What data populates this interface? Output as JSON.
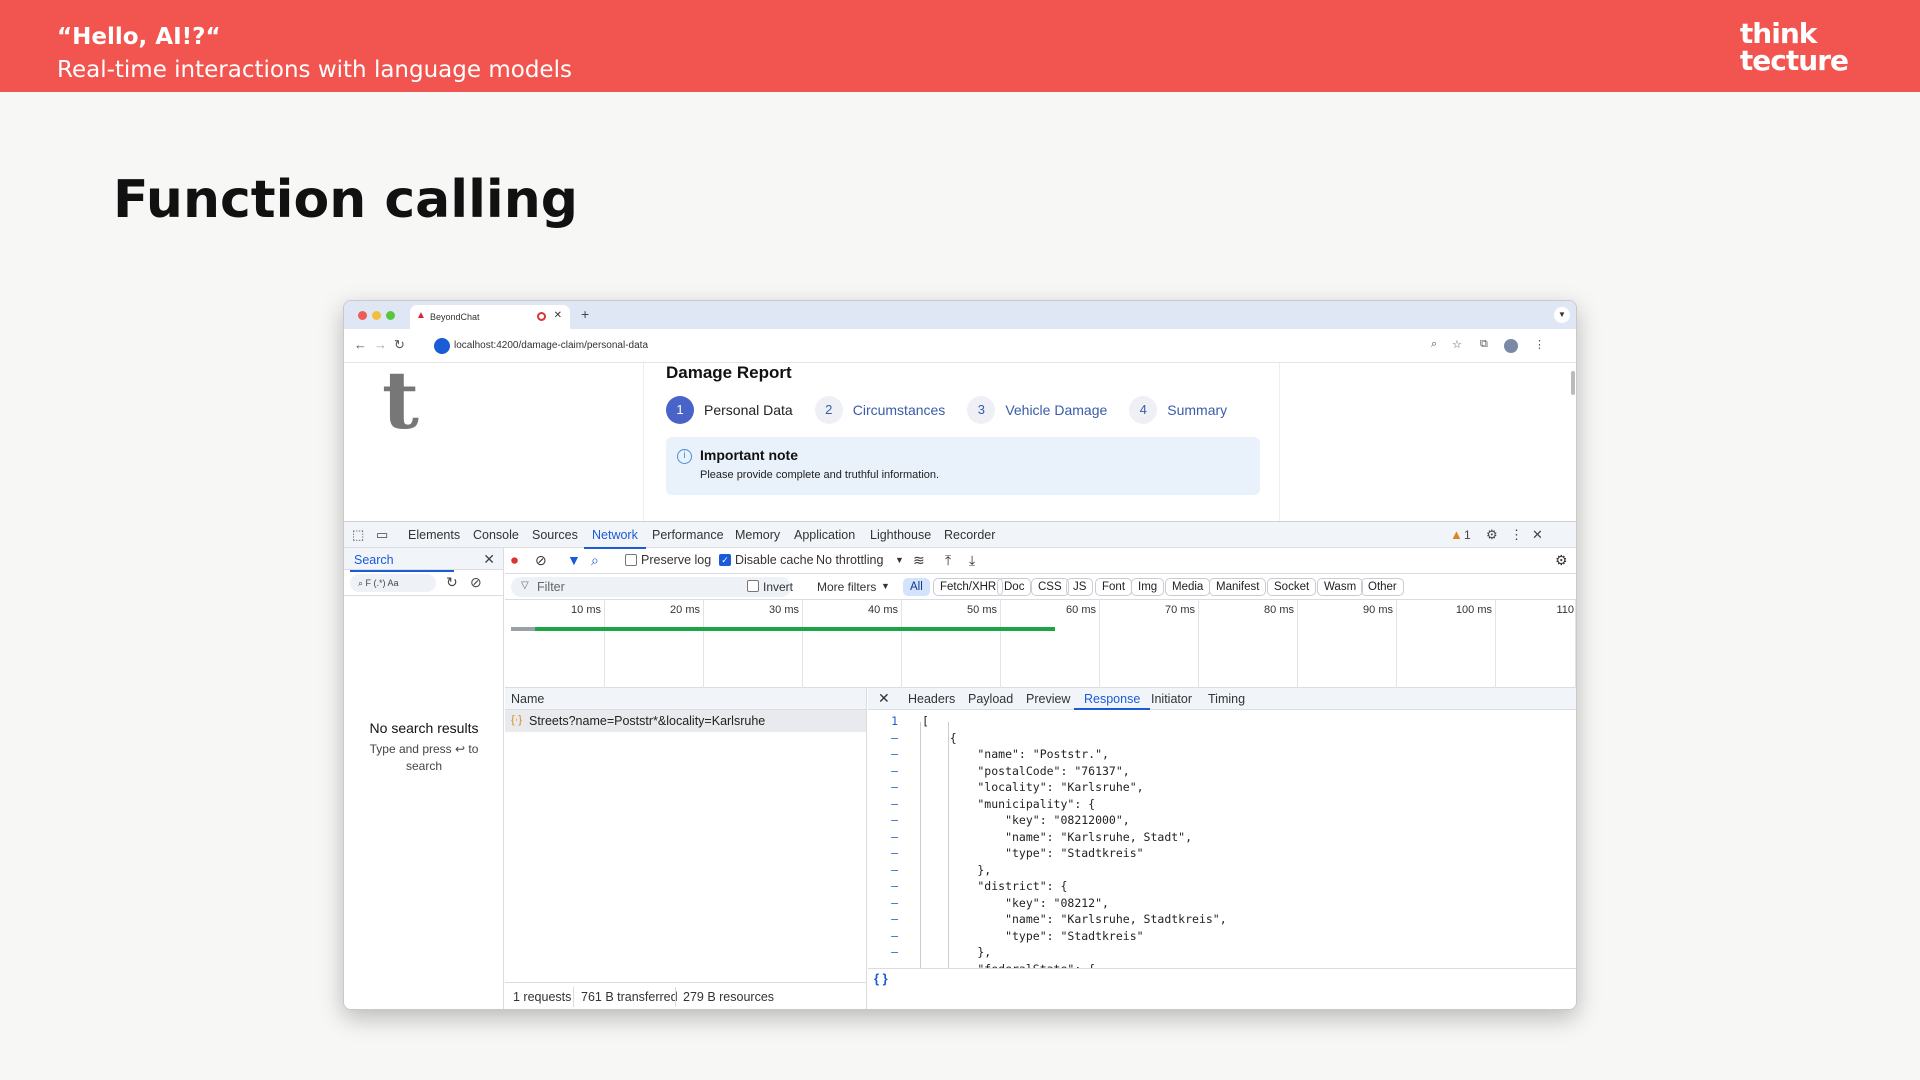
{
  "slide": {
    "header_title": "“Hello, AI!?“",
    "header_subtitle": "Real-time interactions with language models",
    "logo_line1": "think",
    "logo_line2": "tecture",
    "title": "Function calling"
  },
  "browser": {
    "tab_title": "BeyondChat",
    "url": "localhost:4200/damage-claim/personal-data"
  },
  "page": {
    "heading": "Damage Report",
    "steps": [
      {
        "num": "1",
        "label": "Personal Data"
      },
      {
        "num": "2",
        "label": "Circumstances"
      },
      {
        "num": "3",
        "label": "Vehicle Damage"
      },
      {
        "num": "4",
        "label": "Summary"
      }
    ],
    "note_title": "Important note",
    "note_text": "Please provide complete and truthful information."
  },
  "devtools": {
    "tabs": [
      "Elements",
      "Console",
      "Sources",
      "Network",
      "Performance",
      "Memory",
      "Application",
      "Lighthouse",
      "Recorder"
    ],
    "active_tab": "Network",
    "warning_count": "1",
    "search": {
      "label": "Search",
      "box_text": "F (.*) Aa",
      "no_results": "No search results",
      "hint": "Type and press ↩ to search"
    },
    "toolbar": {
      "preserve_log": "Preserve log",
      "disable_cache": "Disable cache",
      "throttling": "No throttling"
    },
    "filter": {
      "placeholder": "Filter",
      "invert": "Invert",
      "more_filters": "More filters",
      "chips": [
        "All",
        "Fetch/XHR",
        "Doc",
        "CSS",
        "JS",
        "Font",
        "Img",
        "Media",
        "Manifest",
        "Socket",
        "Wasm",
        "Other"
      ]
    },
    "timeline_ticks": [
      "10 ms",
      "20 ms",
      "30 ms",
      "40 ms",
      "50 ms",
      "60 ms",
      "70 ms",
      "80 ms",
      "90 ms",
      "100 ms",
      "110"
    ],
    "list": {
      "column": "Name",
      "request": "Streets?name=Poststr*&locality=Karlsruhe"
    },
    "response_tabs": [
      "Headers",
      "Payload",
      "Preview",
      "Response",
      "Initiator",
      "Timing"
    ],
    "active_response_tab": "Response",
    "code": [
      {
        "ln": "1",
        "text": "["
      },
      {
        "ln": "–",
        "text": "    {"
      },
      {
        "ln": "–",
        "text": "        \"name\": \"Poststr.\","
      },
      {
        "ln": "–",
        "text": "        \"postalCode\": \"76137\","
      },
      {
        "ln": "–",
        "text": "        \"locality\": \"Karlsruhe\","
      },
      {
        "ln": "–",
        "text": "        \"municipality\": {"
      },
      {
        "ln": "–",
        "text": "            \"key\": \"08212000\","
      },
      {
        "ln": "–",
        "text": "            \"name\": \"Karlsruhe, Stadt\","
      },
      {
        "ln": "–",
        "text": "            \"type\": \"Stadtkreis\""
      },
      {
        "ln": "–",
        "text": "        },"
      },
      {
        "ln": "–",
        "text": "        \"district\": {"
      },
      {
        "ln": "–",
        "text": "            \"key\": \"08212\","
      },
      {
        "ln": "–",
        "text": "            \"name\": \"Karlsruhe, Stadtkreis\","
      },
      {
        "ln": "–",
        "text": "            \"type\": \"Stadtkreis\""
      },
      {
        "ln": "–",
        "text": "        },"
      },
      {
        "ln": "",
        "text": "        \"federalState\": {"
      }
    ],
    "format_icon": "{ }",
    "status": {
      "requests": "1 requests",
      "transferred": "761 B transferred",
      "resources": "279 B resources"
    }
  }
}
